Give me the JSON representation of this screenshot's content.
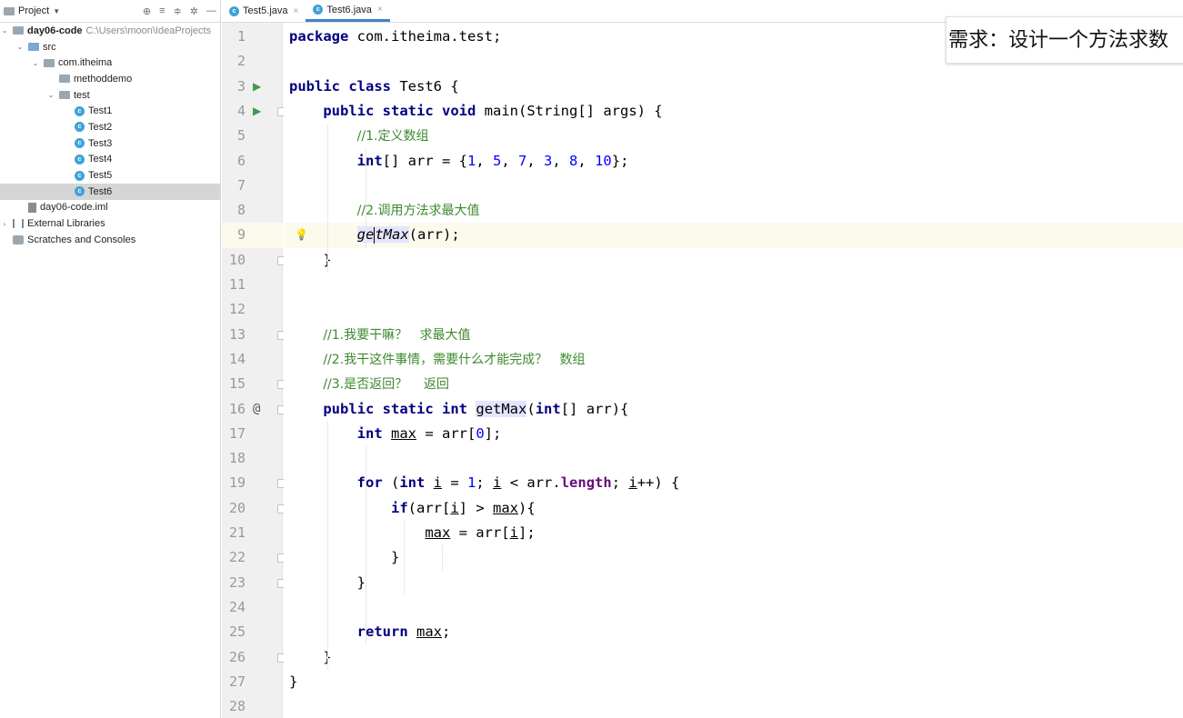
{
  "project": {
    "title": "Project",
    "tree": [
      {
        "label": "day06-code",
        "path": "C:\\Users\\moon\\IdeaProjects",
        "indent": 0,
        "arrow": "open",
        "icon": "folder",
        "bold": true
      },
      {
        "label": "src",
        "indent": 1,
        "arrow": "open",
        "icon": "folder-blue"
      },
      {
        "label": "com.itheima",
        "indent": 2,
        "arrow": "open",
        "icon": "folder"
      },
      {
        "label": "methoddemo",
        "indent": 3,
        "arrow": "",
        "icon": "folder"
      },
      {
        "label": "test",
        "indent": 3,
        "arrow": "open",
        "icon": "folder"
      },
      {
        "label": "Test1",
        "indent": 4,
        "arrow": "",
        "icon": "class"
      },
      {
        "label": "Test2",
        "indent": 4,
        "arrow": "",
        "icon": "class"
      },
      {
        "label": "Test3",
        "indent": 4,
        "arrow": "",
        "icon": "class"
      },
      {
        "label": "Test4",
        "indent": 4,
        "arrow": "",
        "icon": "class"
      },
      {
        "label": "Test5",
        "indent": 4,
        "arrow": "",
        "icon": "class"
      },
      {
        "label": "Test6",
        "indent": 4,
        "arrow": "",
        "icon": "class",
        "selected": true
      },
      {
        "label": "day06-code.iml",
        "indent": 1,
        "arrow": "",
        "icon": "file"
      },
      {
        "label": "External Libraries",
        "indent": 0,
        "arrow": "closed",
        "icon": "lib"
      },
      {
        "label": "Scratches and Consoles",
        "indent": 0,
        "arrow": "",
        "icon": "scratch"
      }
    ]
  },
  "tabs": [
    {
      "label": "Test5.java",
      "active": false
    },
    {
      "label": "Test6.java",
      "active": true
    }
  ],
  "editor": {
    "current_line": 9,
    "lines": [
      "package com.itheima.test;",
      "",
      "public class Test6 {",
      "    public static void main(String[] args) {",
      "        //1.定义数组",
      "        int[] arr = {1, 5, 7, 3, 8, 10};",
      "",
      "        //2.调用方法求最大值",
      "        getMax(arr);",
      "    }",
      "",
      "",
      "    //1.我要干嘛？   求最大值",
      "    //2.我干这件事情，需要什么才能完成？   数组",
      "    //3.是否返回？    返回",
      "    public static int getMax(int[] arr){",
      "        int max = arr[0];",
      "",
      "        for (int i = 1; i < arr.length; i++) {",
      "            if(arr[i] > max){",
      "                max = arr[i];",
      "            }",
      "        }",
      "",
      "        return max;",
      "    }",
      "}",
      ""
    ]
  },
  "banner": {
    "text": "需求：设计一个方法求数"
  },
  "colors": {
    "keyword": "#000080",
    "number": "#0000ff",
    "comment": "#3c8a2e",
    "tab_underline": "#4083c9",
    "run_icon": "#3d9a50"
  }
}
